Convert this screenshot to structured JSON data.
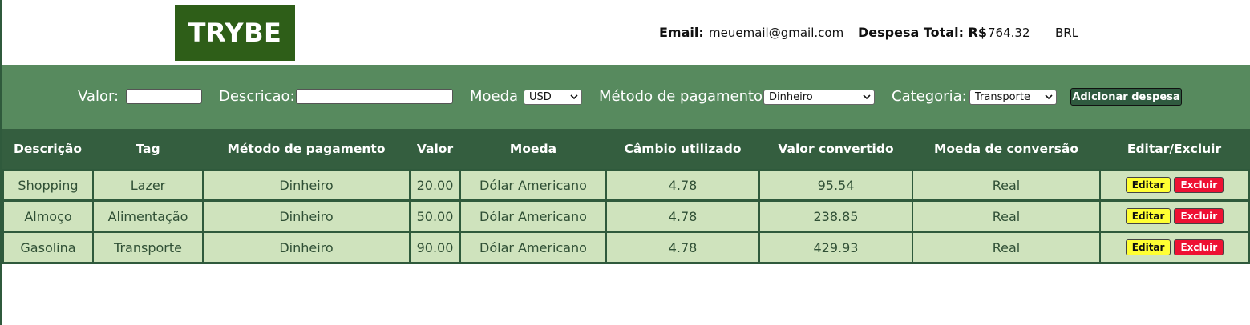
{
  "header": {
    "logo": "TRYBE",
    "email_label": "Email:",
    "email": "meuemail@gmail.com",
    "total_label": "Despesa Total: R$",
    "total": "764.32",
    "currency": "BRL"
  },
  "form": {
    "value_label": "Valor:",
    "value_input": "",
    "description_label": "Descricao:",
    "description_input": "",
    "currency_label": "Moeda",
    "currency_selected": "USD",
    "method_label": "Método de pagamento:",
    "method_selected": "Dinheiro",
    "category_label": "Categoria:",
    "category_selected": "Transporte",
    "add_button": "Adicionar despesa"
  },
  "table": {
    "headers": [
      "Descrição",
      "Tag",
      "Método de pagamento",
      "Valor",
      "Moeda",
      "Câmbio utilizado",
      "Valor convertido",
      "Moeda de conversão",
      "Editar/Excluir"
    ],
    "edit_label": "Editar",
    "delete_label": "Excluir",
    "rows": [
      {
        "description": "Shopping",
        "tag": "Lazer",
        "method": "Dinheiro",
        "value": "20.00",
        "currency": "Dólar Americano",
        "rate": "4.78",
        "converted": "95.54",
        "conversion_currency": "Real"
      },
      {
        "description": "Almoço",
        "tag": "Alimentação",
        "method": "Dinheiro",
        "value": "50.00",
        "currency": "Dólar Americano",
        "rate": "4.78",
        "converted": "238.85",
        "conversion_currency": "Real"
      },
      {
        "description": "Gasolina",
        "tag": "Transporte",
        "method": "Dinheiro",
        "value": "90.00",
        "currency": "Dólar Americano",
        "rate": "4.78",
        "converted": "429.93",
        "conversion_currency": "Real"
      }
    ]
  },
  "colors": {
    "logo_bg": "#2e5e18",
    "form_bg": "#578a5e",
    "table_header_bg": "#345e3f",
    "cell_bg": "#cfe3bd",
    "edit_btn": "#ffff33",
    "delete_btn": "#ee1133"
  }
}
